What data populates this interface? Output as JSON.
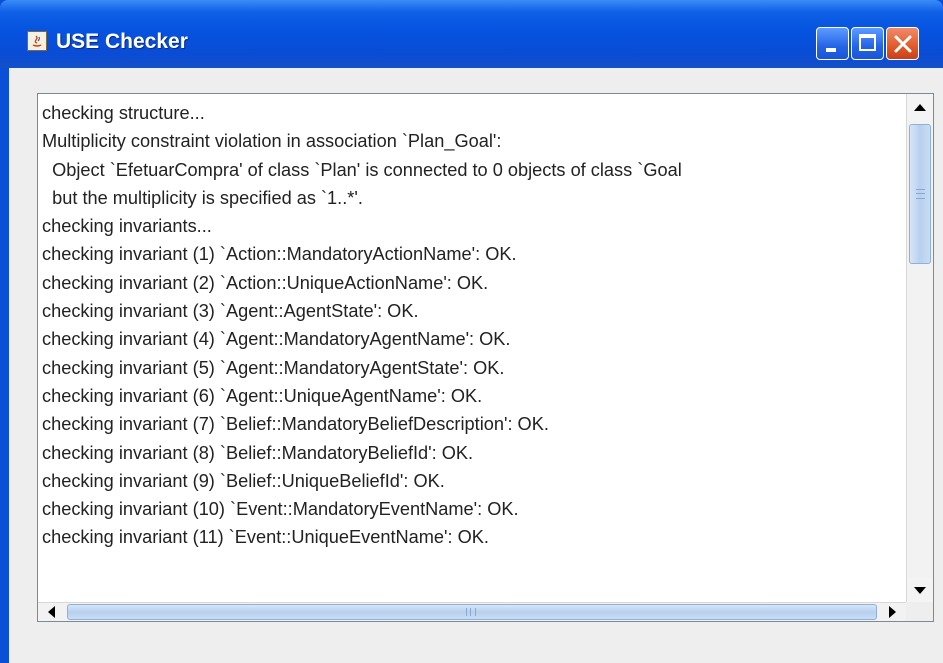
{
  "window": {
    "title": "USE Checker",
    "icon": "java-icon",
    "controls": {
      "minimize_icon": "minimize-icon",
      "maximize_icon": "maximize-icon",
      "close_icon": "close-icon"
    },
    "colors": {
      "titlebar": "#0553e0",
      "close_button": "#e15a2a"
    }
  },
  "output": {
    "lines": [
      "checking structure...",
      "Multiplicity constraint violation in association `Plan_Goal':",
      "  Object `EfetuarCompra' of class `Plan' is connected to 0 objects of class `Goal",
      "  but the multiplicity is specified as `1..*'.",
      "checking invariants...",
      "checking invariant (1) `Action::MandatoryActionName': OK.",
      "checking invariant (2) `Action::UniqueActionName': OK.",
      "checking invariant (3) `Agent::AgentState': OK.",
      "checking invariant (4) `Agent::MandatoryAgentName': OK.",
      "checking invariant (5) `Agent::MandatoryAgentState': OK.",
      "checking invariant (6) `Agent::UniqueAgentName': OK.",
      "checking invariant (7) `Belief::MandatoryBeliefDescription': OK.",
      "checking invariant (8) `Belief::MandatoryBeliefId': OK.",
      "checking invariant (9) `Belief::UniqueBeliefId': OK.",
      "checking invariant (10) `Event::MandatoryEventName': OK.",
      "checking invariant (11) `Event::UniqueEventName': OK."
    ]
  }
}
